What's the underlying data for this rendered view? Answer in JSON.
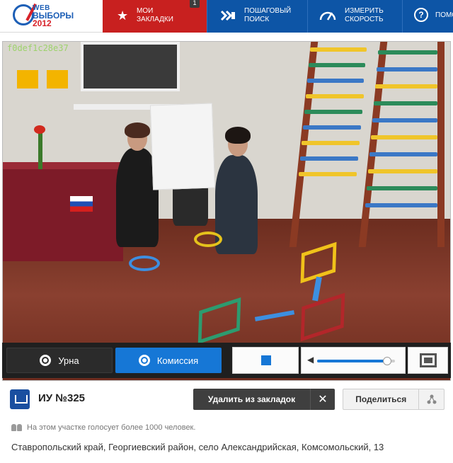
{
  "logo": {
    "line1": "WEB",
    "line2": "ВЫБОРЫ",
    "line3": "2012"
  },
  "nav": {
    "bookmarks": {
      "label_line1": "МОИ",
      "label_line2": "ЗАКЛАДКИ",
      "badge": "1",
      "icon": "star-icon"
    },
    "search": {
      "label_line1": "ПОШАГОВЫЙ",
      "label_line2": "ПОИСК",
      "icon": "step-search-icon"
    },
    "speed": {
      "label_line1": "ИЗМЕРИТЬ",
      "label_line2": "СКОРОСТЬ",
      "icon": "speedometer-icon"
    },
    "help": {
      "label": "ПОМО",
      "icon": "help-icon"
    }
  },
  "video": {
    "watermark": "f0def1c28e37",
    "controls": {
      "urna_label": "Урна",
      "commission_label": "Комиссия",
      "volume_level": 0.9
    }
  },
  "station": {
    "title": "ИУ №325",
    "remove_label": "Удалить из закладок",
    "share_label": "Поделиться",
    "voters_note": "На этом участке голосует более 1000 человек.",
    "address": "Ставропольский край, Георгиевский район, село Александрийская, Комсомольский, 13"
  },
  "colors": {
    "accent_red": "#c8201f",
    "accent_blue": "#0d55a6",
    "active_blue": "#1677d6"
  }
}
